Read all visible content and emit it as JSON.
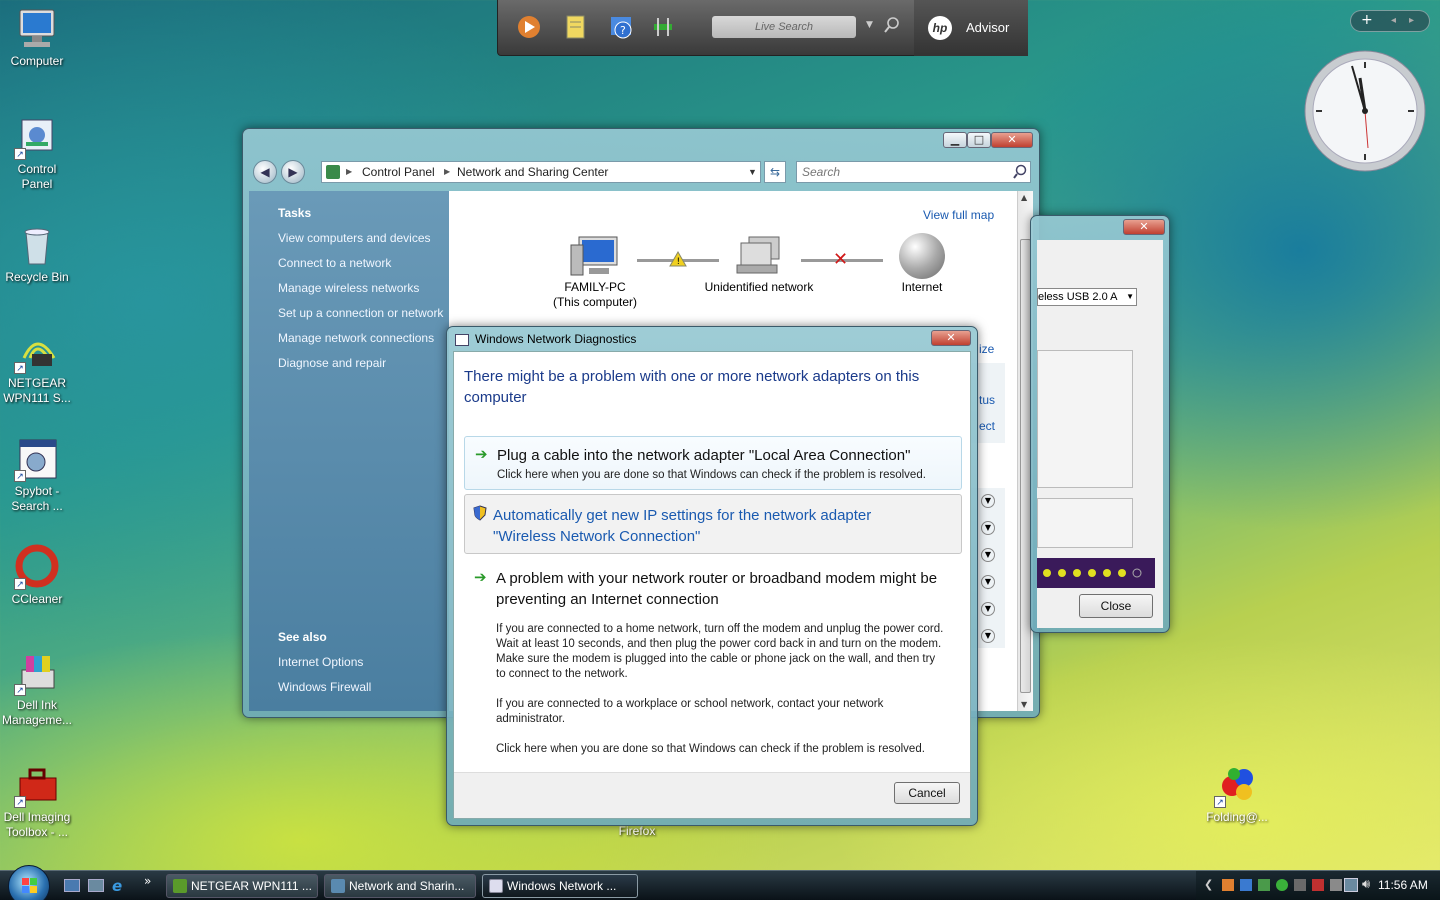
{
  "desktop_icons": [
    {
      "label": "Computer",
      "icon": "computer-icon"
    },
    {
      "label": "Control\nPanel",
      "icon": "control-panel-icon"
    },
    {
      "label": "Recycle Bin",
      "icon": "recycle-bin-icon"
    },
    {
      "label": "NETGEAR\nWPN111 S...",
      "icon": "netgear-icon"
    },
    {
      "label": "Spybot -\nSearch ...",
      "icon": "spybot-icon"
    },
    {
      "label": "CCleaner",
      "icon": "ccleaner-icon"
    },
    {
      "label": "Dell Ink\nManageme...",
      "icon": "printer-icon"
    },
    {
      "label": "Dell Imaging\nToolbox - ...",
      "icon": "toolbox-icon"
    },
    {
      "label": "Folding@...",
      "icon": "folding-icon"
    },
    {
      "label": "Firefox",
      "icon": "firefox-icon"
    }
  ],
  "topbar": {
    "search_placeholder": "Live Search",
    "brand": "Advisor"
  },
  "nsc": {
    "breadcrumb": [
      "Control Panel",
      "Network and Sharing Center"
    ],
    "search_placeholder": "Search",
    "tasks_header": "Tasks",
    "tasks": [
      "View computers and devices",
      "Connect to a network",
      "Manage wireless networks",
      "Set up a connection or network",
      "Manage network connections",
      "Diagnose and repair"
    ],
    "see_also_header": "See also",
    "see_also": [
      "Internet Options",
      "Windows Firewall"
    ],
    "view_full_map": "View full map",
    "map": {
      "computer_name": "FAMILY-PC",
      "computer_sub": "(This computer)",
      "network": "Unidentified network",
      "internet": "Internet"
    },
    "partial_links": [
      "ize",
      "tus",
      "ect"
    ]
  },
  "rwin": {
    "select_value": "eless USB 2.0 A",
    "close_label": "Close"
  },
  "dialog": {
    "title": "Windows Network Diagnostics",
    "heading": "There might be a problem with one or more network adapters on this computer",
    "options": [
      {
        "title": "Plug a cable into the network adapter \"Local Area Connection\"",
        "sub": "Click here when you are done so that Windows can check if the problem is resolved."
      },
      {
        "title": "Automatically get new IP settings for the network adapter \"Wireless Network Connection\""
      },
      {
        "title": "A problem with your network router or broadband modem might be preventing an Internet connection",
        "p1": "If you are connected to a home network, turn off the modem and unplug the power cord. Wait at least 10 seconds, and then plug the power cord back in and turn on the modem. Make sure the modem is plugged into the cable or phone jack on the wall, and then try to connect to the network.",
        "p2": "If you are connected to a workplace or school network, contact your network administrator.",
        "p3": "Click here when you are done so that Windows can check if the problem is resolved."
      }
    ],
    "cancel_label": "Cancel"
  },
  "taskbar": {
    "tasks": [
      "NETGEAR WPN111 ...",
      "Network and Sharin...",
      "Windows Network ..."
    ],
    "clock": "11:56 AM",
    "chevron": "»"
  }
}
